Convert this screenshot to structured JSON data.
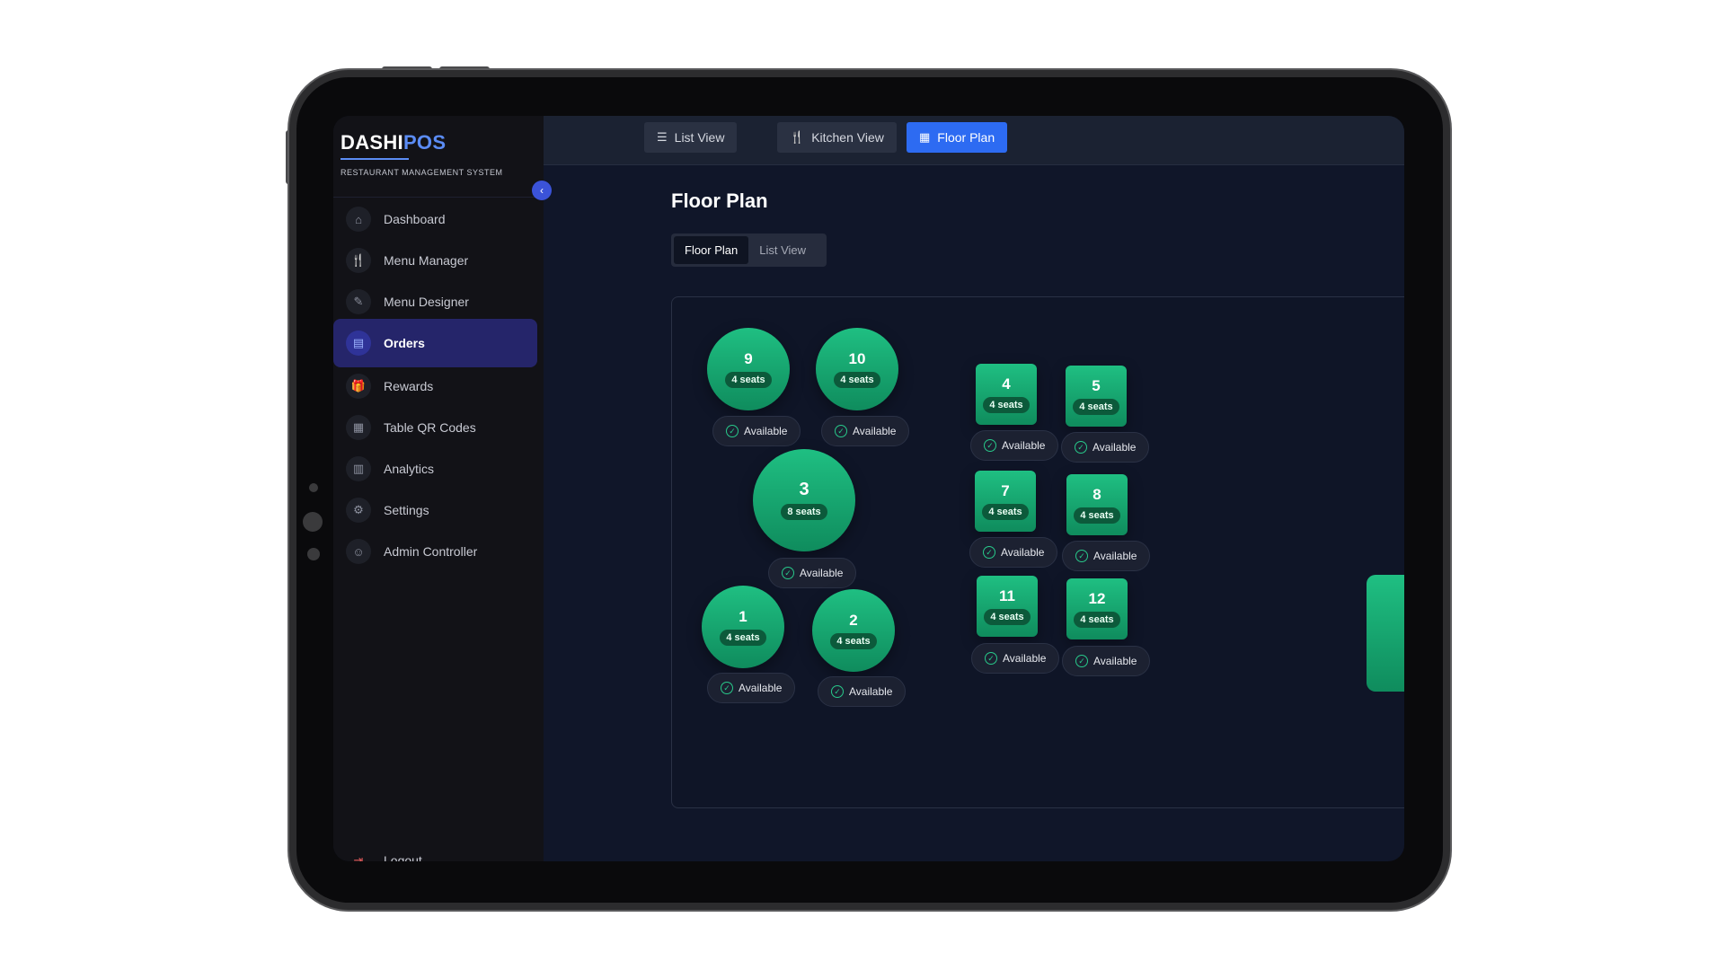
{
  "brand": {
    "name_part1": "DASHI",
    "name_part2": "POS",
    "tagline": "RESTAURANT MANAGEMENT SYSTEM"
  },
  "sidebar": {
    "collapse_icon": "chevron-left-icon",
    "items": [
      {
        "label": "Dashboard",
        "icon": "home-icon",
        "glyph": "⌂"
      },
      {
        "label": "Menu Manager",
        "icon": "utensils-icon",
        "glyph": "🍴"
      },
      {
        "label": "Menu Designer",
        "icon": "pencil-icon",
        "glyph": "✎"
      },
      {
        "label": "Orders",
        "icon": "clipboard-icon",
        "glyph": "▤",
        "active": true
      },
      {
        "label": "Rewards",
        "icon": "gift-icon",
        "glyph": "🎁"
      },
      {
        "label": "Table QR Codes",
        "icon": "qr-code-icon",
        "glyph": "▦"
      },
      {
        "label": "Analytics",
        "icon": "bar-chart-icon",
        "glyph": "▥"
      },
      {
        "label": "Settings",
        "icon": "gear-icon",
        "glyph": "⚙"
      },
      {
        "label": "Admin Controller",
        "icon": "user-cog-icon",
        "glyph": "☺"
      }
    ],
    "logout": {
      "label": "Logout",
      "icon": "logout-icon",
      "glyph": "⇥"
    }
  },
  "topbar": {
    "tabs": [
      {
        "label": "List View",
        "icon": "list-icon",
        "glyph": "☰"
      },
      {
        "label": "Kitchen View",
        "icon": "utensils-icon",
        "glyph": "🍴"
      },
      {
        "label": "Floor Plan",
        "icon": "grid-icon",
        "glyph": "▦",
        "active": true
      }
    ]
  },
  "main": {
    "title": "Floor Plan",
    "segment": {
      "options": [
        "Floor Plan",
        "List View"
      ],
      "selected": "Floor Plan"
    }
  },
  "tables": [
    {
      "number": "9",
      "seats": "4 seats",
      "status": "Available"
    },
    {
      "number": "10",
      "seats": "4 seats",
      "status": "Available"
    },
    {
      "number": "3",
      "seats": "8 seats",
      "status": "Available"
    },
    {
      "number": "1",
      "seats": "4 seats",
      "status": "Available"
    },
    {
      "number": "2",
      "seats": "4 seats",
      "status": "Available"
    },
    {
      "number": "4",
      "seats": "4 seats",
      "status": "Available"
    },
    {
      "number": "5",
      "seats": "4 seats",
      "status": "Available"
    },
    {
      "number": "7",
      "seats": "4 seats",
      "status": "Available"
    },
    {
      "number": "8",
      "seats": "4 seats",
      "status": "Available"
    },
    {
      "number": "11",
      "seats": "4 seats",
      "status": "Available"
    },
    {
      "number": "12",
      "seats": "4 seats",
      "status": "Available"
    }
  ],
  "colors": {
    "accent": "#2d6bf2",
    "table_green": "#1fbf82",
    "available_check": "#28c98a",
    "logout": "#e25a5a"
  }
}
